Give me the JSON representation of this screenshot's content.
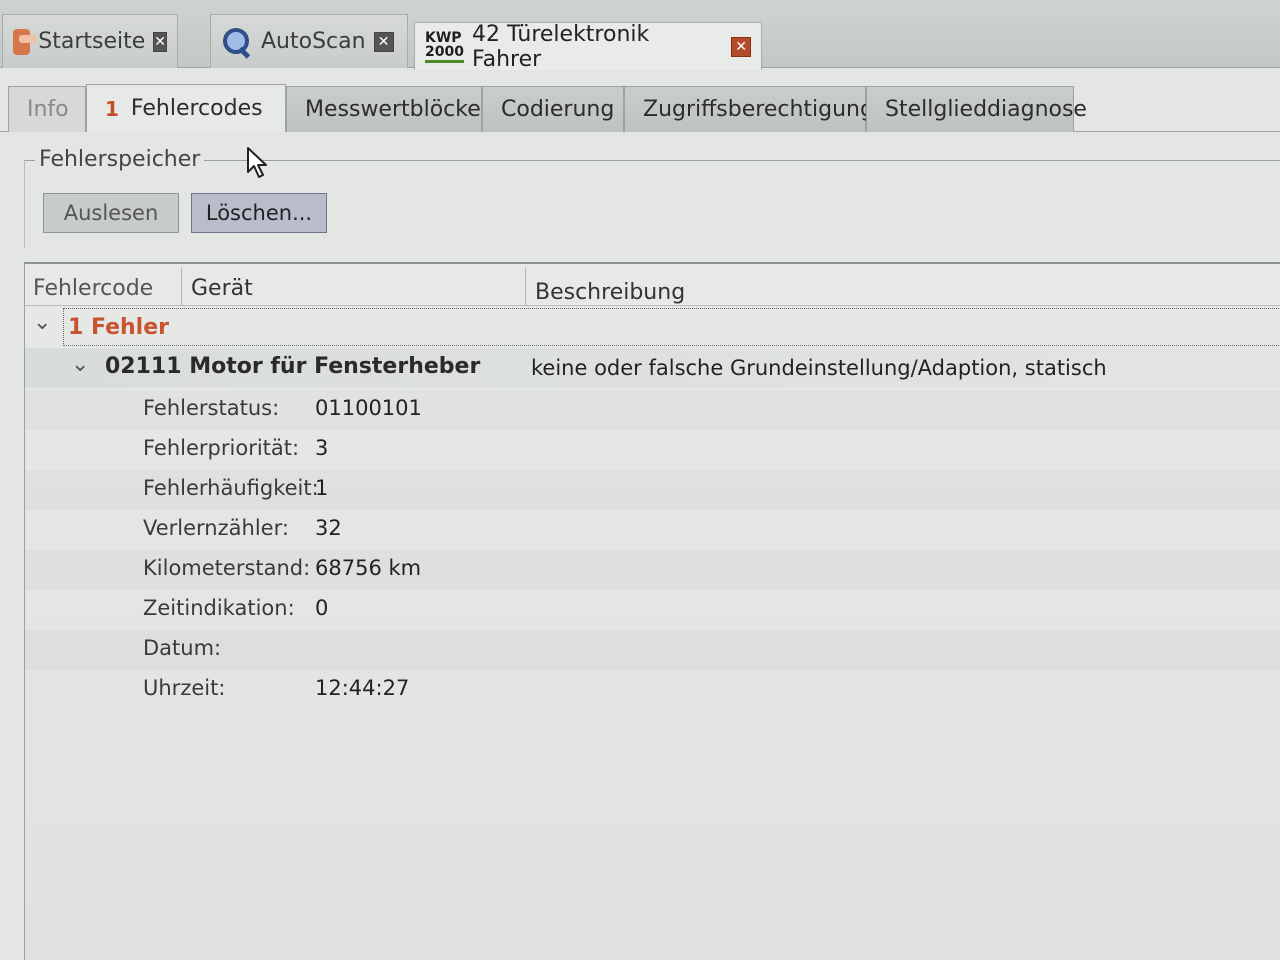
{
  "doc_tabs": [
    {
      "label": "Startseite",
      "icon": "car-icon"
    },
    {
      "label": "AutoScan",
      "icon": "magnifier-icon"
    },
    {
      "label": "42 Türelektronik Fahrer",
      "icon": "kwp-icon",
      "icon_text": "KWP\n2000"
    }
  ],
  "close_glyph": "✕",
  "sub_tabs": [
    {
      "label": "Info"
    },
    {
      "label": "Fehlercodes",
      "badge": "1"
    },
    {
      "label": "Messwertblöcke"
    },
    {
      "label": "Codierung"
    },
    {
      "label": "Zugriffsberechtigung"
    },
    {
      "label": "Stellglieddiagnose"
    }
  ],
  "fault_memory": {
    "title": "Fehlerspeicher",
    "read_label": "Auslesen",
    "delete_label": "Löschen..."
  },
  "table": {
    "columns": [
      "Fehlercode",
      "Gerät",
      "Beschreibung"
    ],
    "group_label": "1 Fehler",
    "fault": {
      "code_device": "02111 Motor für Fensterheber",
      "description": "keine oder falsche Grundeinstellung/Adaption, statisch"
    },
    "details": [
      {
        "label": "Fehlerstatus:",
        "value": "01100101"
      },
      {
        "label": "Fehlerpriorität:",
        "value": "3"
      },
      {
        "label": "Fehlerhäufigkeit:",
        "value": "1"
      },
      {
        "label": "Verlernzähler:",
        "value": "32"
      },
      {
        "label": "Kilometerstand:",
        "value": "68756 km"
      },
      {
        "label": "Zeitindikation:",
        "value": "0"
      },
      {
        "label": "Datum:",
        "value": ""
      },
      {
        "label": "Uhrzeit:",
        "value": "12:44:27"
      }
    ]
  },
  "chevron_glyph": "⌄"
}
